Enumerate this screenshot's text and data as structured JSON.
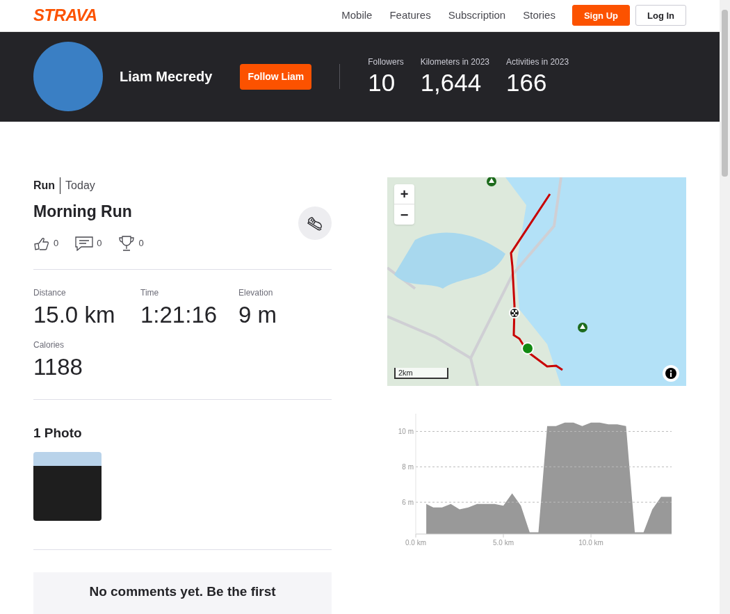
{
  "header": {
    "logo": "STRAVA",
    "nav": [
      "Mobile",
      "Features",
      "Subscription",
      "Stories"
    ],
    "buttons": [
      {
        "label": "Sign Up",
        "kind": "primary"
      },
      {
        "label": "Log In",
        "kind": "secondary"
      }
    ]
  },
  "athlete": {
    "name": "Liam Mecredy",
    "follow_button": "Follow Liam",
    "stats": [
      {
        "label": "Followers",
        "value": "10"
      },
      {
        "label": "Kilometers in 2023",
        "value": "1,644"
      },
      {
        "label": "Activities in 2023",
        "value": "166"
      }
    ]
  },
  "activity": {
    "type": "Run",
    "date": "Today",
    "title": "Morning Run",
    "kudos": "0",
    "comments": "0",
    "achievements": "0",
    "stats": [
      {
        "label": "Distance",
        "value": "15.0 km"
      },
      {
        "label": "Time",
        "value": "1:21:16"
      },
      {
        "label": "Elevation",
        "value": "9 m"
      },
      {
        "label": "Calories",
        "value": "1188"
      }
    ]
  },
  "photos": {
    "heading": "1 Photo"
  },
  "comments": {
    "empty_message": "No comments yet. Be the first"
  },
  "map": {
    "zoom_in": "+",
    "zoom_out": "−",
    "scale": "2km"
  },
  "elevation": {
    "chart_data": {
      "type": "area",
      "x": [
        0.6,
        1.0,
        1.5,
        2.0,
        2.5,
        3.0,
        3.5,
        4.0,
        4.5,
        5.0,
        5.5,
        6.0,
        6.5,
        7.0,
        7.5,
        8.0,
        8.5,
        9.0,
        9.5,
        10.0,
        10.5,
        11.0,
        11.5,
        12.0,
        12.5,
        13.0,
        13.5,
        14.0,
        14.6
      ],
      "series": [
        {
          "color": "#999999",
          "values": [
            5.9,
            5.7,
            5.7,
            5.9,
            5.6,
            5.7,
            5.9,
            5.9,
            5.9,
            5.8,
            6.5,
            5.8,
            4.3,
            4.3,
            10.3,
            10.3,
            10.5,
            10.5,
            10.3,
            10.5,
            10.5,
            10.4,
            10.4,
            10.3,
            4.3,
            4.3,
            5.6,
            6.3,
            6.3
          ]
        }
      ],
      "xlim": [
        0,
        14.6
      ],
      "ylim": [
        4.2,
        11
      ],
      "grid": true,
      "xticks": [
        {
          "value": 0,
          "label": "0.0 km"
        },
        {
          "value": 5,
          "label": "5.0 km"
        },
        {
          "value": 10,
          "label": "10.0 km"
        }
      ],
      "yticks": [
        {
          "value": 6,
          "label": "6 m"
        },
        {
          "value": 8,
          "label": "8 m"
        },
        {
          "value": 10,
          "label": "10 m"
        }
      ]
    }
  }
}
